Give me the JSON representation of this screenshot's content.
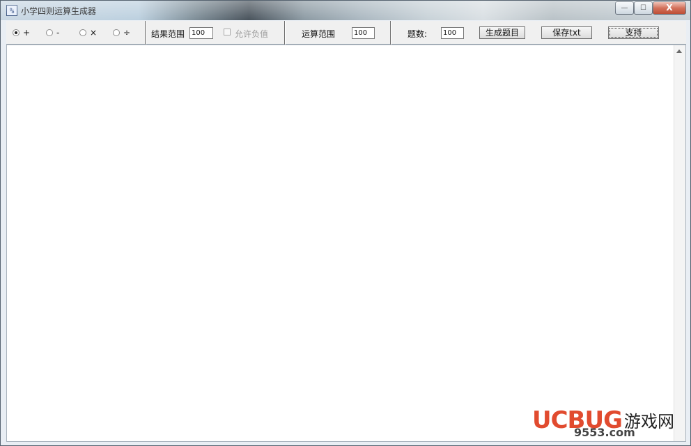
{
  "window": {
    "title": "小学四则运算生成器",
    "icon_glyph": "%",
    "controls": {
      "minimize": "—",
      "maximize": "☐",
      "close": "X"
    }
  },
  "toolbar": {
    "operators": [
      {
        "label": "+",
        "selected": true
      },
      {
        "label": "-",
        "selected": false
      },
      {
        "label": "×",
        "selected": false
      },
      {
        "label": "÷",
        "selected": false
      }
    ],
    "result_range_label": "结果范围",
    "result_range_value": "100",
    "allow_negative_label": "允许负值",
    "allow_negative_checked": false,
    "operand_range_label": "运算范围",
    "operand_range_value": "100",
    "count_label": "题数:",
    "count_value": "100",
    "generate_button": "生成题目",
    "save_button": "保存txt",
    "support_button": "支持"
  },
  "content": {
    "text": ""
  },
  "watermark": {
    "brand": "UCBUG",
    "cn": "游戏网",
    "sub": "9553.com"
  }
}
